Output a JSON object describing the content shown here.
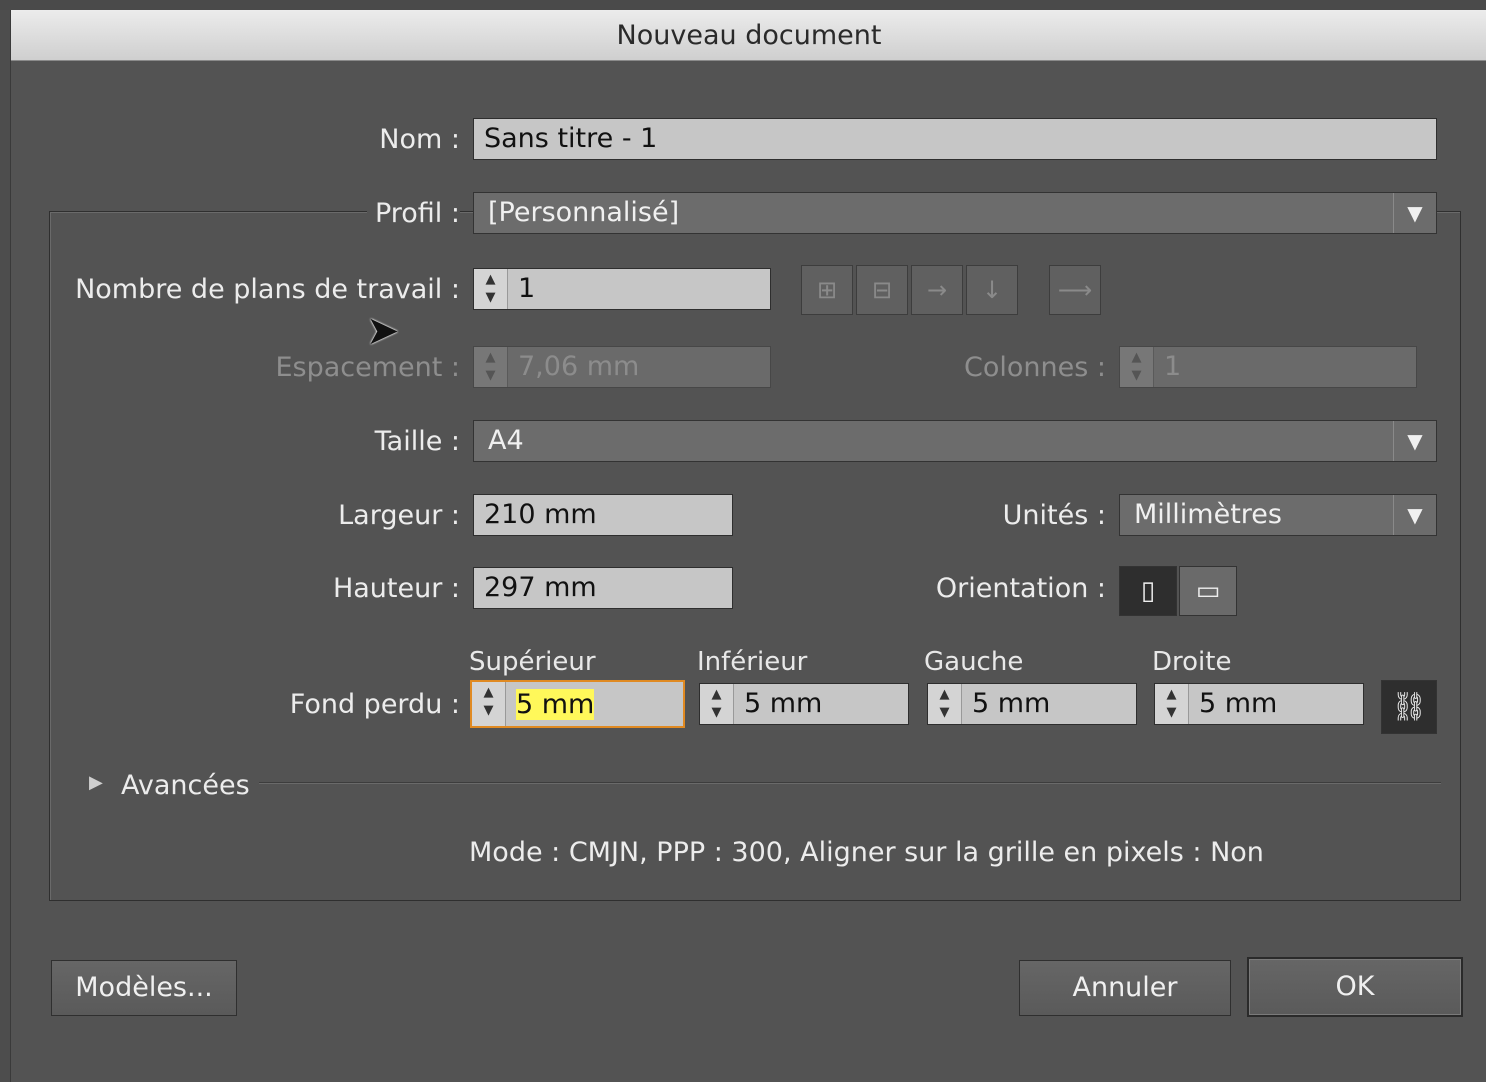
{
  "dialog": {
    "title": "Nouveau document"
  },
  "name": {
    "label": "Nom :",
    "value": "Sans titre - 1"
  },
  "profile": {
    "label": "Profil :",
    "value": "[Personnalisé]"
  },
  "artboards": {
    "label": "Nombre de plans de travail :",
    "value": "1"
  },
  "spacing": {
    "label": "Espacement :",
    "value": "7,06 mm"
  },
  "columns": {
    "label": "Colonnes :",
    "value": "1"
  },
  "size": {
    "label": "Taille :",
    "value": "A4"
  },
  "width": {
    "label": "Largeur :",
    "value": "210 mm"
  },
  "height": {
    "label": "Hauteur :",
    "value": "297 mm"
  },
  "units": {
    "label": "Unités :",
    "value": "Millimètres"
  },
  "orientation": {
    "label": "Orientation :",
    "selected": "portrait"
  },
  "bleed": {
    "label": "Fond perdu :",
    "top_label": "Supérieur",
    "top": "5 mm",
    "bottom_label": "Inférieur",
    "bottom": "5 mm",
    "left_label": "Gauche",
    "left": "5 mm",
    "right_label": "Droite",
    "right": "5 mm"
  },
  "advanced": {
    "label": "Avancées"
  },
  "summary": "Mode : CMJN, PPP : 300, Aligner sur la grille en pixels : Non",
  "buttons": {
    "templates": "Modèles...",
    "cancel": "Annuler",
    "ok": "OK"
  },
  "colors": {
    "background": "#535353",
    "field": "#c6c6c6",
    "focus_border": "#e08a22",
    "highlight": "#fff85a"
  }
}
